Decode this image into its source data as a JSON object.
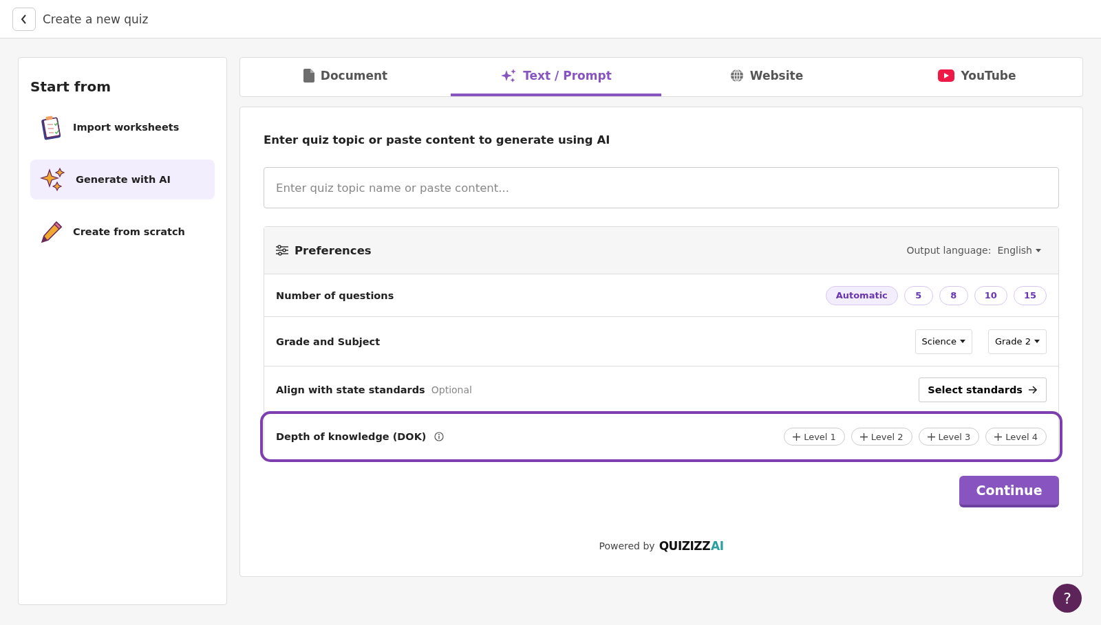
{
  "header": {
    "title": "Create a new quiz"
  },
  "sidebar": {
    "title": "Start from",
    "items": [
      {
        "kind": "clipboard",
        "label": "Import worksheets",
        "selected": false
      },
      {
        "kind": "sparkles",
        "label": "Generate with AI",
        "selected": true
      },
      {
        "kind": "pencil",
        "label": "Create from scratch",
        "selected": false
      }
    ]
  },
  "tabs": [
    {
      "kind": "document",
      "label": "Document",
      "selected": false
    },
    {
      "kind": "sparkles",
      "label": "Text / Prompt",
      "selected": true
    },
    {
      "kind": "globe",
      "label": "Website",
      "selected": false
    },
    {
      "kind": "youtube",
      "label": "YouTube",
      "selected": false
    }
  ],
  "prompt": {
    "heading": "Enter quiz topic or paste content to generate using AI",
    "placeholder": "Enter quiz topic name or paste content..."
  },
  "preferences": {
    "title": "Preferences",
    "language_label": "Output language:",
    "language": "English",
    "rows": [
      {
        "kind": "chips",
        "label": "Number of questions",
        "highlighted": false,
        "options": [
          {
            "label": "Automatic",
            "selected": true
          },
          {
            "label": "5",
            "selected": false
          },
          {
            "label": "8",
            "selected": false
          },
          {
            "label": "10",
            "selected": false
          },
          {
            "label": "15",
            "selected": false
          }
        ]
      },
      {
        "kind": "dropdowns",
        "label": "Grade and Subject",
        "highlighted": false,
        "dropdowns": [
          "Science",
          "Grade 2"
        ]
      },
      {
        "kind": "link",
        "label": "Align with state standards",
        "note": "Optional",
        "highlighted": false,
        "button": "Select standards"
      },
      {
        "kind": "levels",
        "label": "Depth of knowledge (DOK)",
        "highlighted": true,
        "info": true,
        "levels": [
          "Level 1",
          "Level 2",
          "Level 3",
          "Level 4"
        ]
      }
    ]
  },
  "continue_button": "Continue",
  "footer": {
    "prefix": "Powered by",
    "brand": "QUIZIZZ",
    "brand_suffix": "AI"
  },
  "help_button": "?"
}
